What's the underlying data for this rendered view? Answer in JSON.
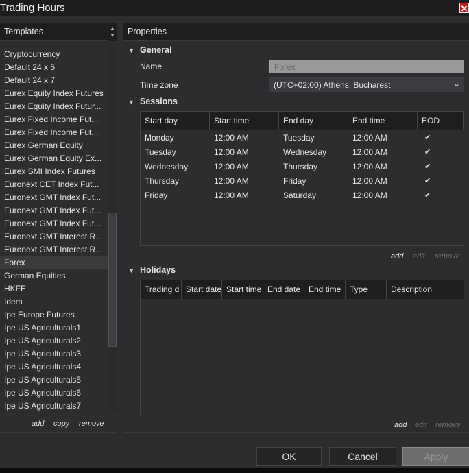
{
  "window": {
    "title": "Trading Hours",
    "close_icon": "close-icon"
  },
  "templates": {
    "header": "Templates",
    "items": [
      "Cryptocurrency",
      "Default 24 x 5",
      "Default 24 x 7",
      "Eurex Equity Index Futures",
      "Eurex Equity Index Futur...",
      "Eurex Fixed Income Fut...",
      "Eurex Fixed Income Fut...",
      "Eurex German Equity",
      "Eurex German Equity Ex...",
      "Eurex SMI Index Futures",
      "Euronext CET Index Fut...",
      "Euronext GMT Index Fut...",
      "Euronext GMT Index Fut...",
      "Euronext GMT Index Fut...",
      "Euronext GMT Interest R...",
      "Euronext GMT Interest R...",
      "Forex",
      "German Equities",
      "HKFE",
      "Idem",
      "Ipe Europe Futures",
      "Ipe US Agriculturals1",
      "Ipe US Agriculturals2",
      "Ipe US Agriculturals3",
      "Ipe US Agriculturals4",
      "Ipe US Agriculturals5",
      "Ipe US Agriculturals6",
      "Ipe US Agriculturals7"
    ],
    "selected": "Forex",
    "add": "add",
    "copy": "copy",
    "remove": "remove"
  },
  "properties": {
    "header": "Properties",
    "general": {
      "label": "General",
      "name_label": "Name",
      "name_value": "Forex",
      "timezone_label": "Time zone",
      "timezone_value": "(UTC+02:00) Athens, Bucharest"
    },
    "sessions": {
      "label": "Sessions",
      "columns": [
        "Start day",
        "Start time",
        "End day",
        "End time",
        "EOD"
      ],
      "rows": [
        [
          "Monday",
          "12:00 AM",
          "Tuesday",
          "12:00 AM",
          true
        ],
        [
          "Tuesday",
          "12:00 AM",
          "Wednesday",
          "12:00 AM",
          true
        ],
        [
          "Wednesday",
          "12:00 AM",
          "Thursday",
          "12:00 AM",
          true
        ],
        [
          "Thursday",
          "12:00 AM",
          "Friday",
          "12:00 AM",
          true
        ],
        [
          "Friday",
          "12:00 AM",
          "Saturday",
          "12:00 AM",
          true
        ]
      ],
      "add": "add",
      "edit": "edit",
      "remove": "remove"
    },
    "holidays": {
      "label": "Holidays",
      "columns": [
        "Trading d",
        "Start date",
        "Start time",
        "End date",
        "End time",
        "Type",
        "Description"
      ],
      "rows": [],
      "add": "add",
      "edit": "edit",
      "remove": "remove"
    }
  },
  "buttons": {
    "ok": "OK",
    "cancel": "Cancel",
    "apply": "Apply"
  }
}
